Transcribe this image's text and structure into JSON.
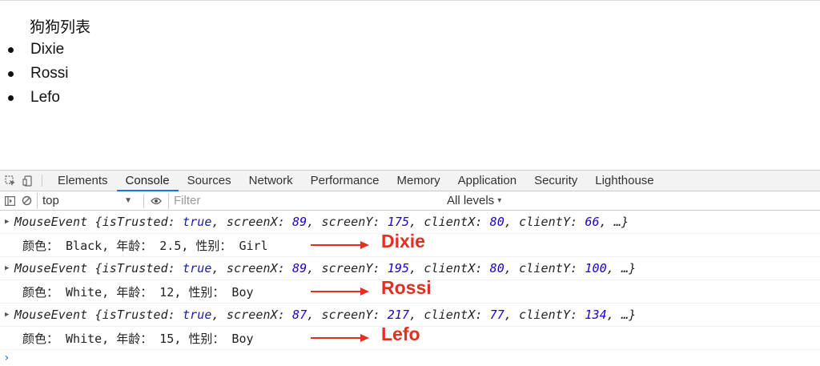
{
  "page": {
    "title": "狗狗列表",
    "dogs": [
      "Dixie",
      "Rossi",
      "Lefo"
    ]
  },
  "devtools": {
    "tabs": [
      "Elements",
      "Console",
      "Sources",
      "Network",
      "Performance",
      "Memory",
      "Application",
      "Security",
      "Lighthouse"
    ],
    "active_tab": "Console",
    "filterbar": {
      "context": "top",
      "filter_placeholder": "Filter",
      "levels": "All levels"
    },
    "messages": [
      {
        "type": "object",
        "name": "MouseEvent",
        "isTrusted": "true",
        "screenX": "89",
        "screenY": "175",
        "clientX": "80",
        "clientY": "66",
        "ellipsis": "…"
      },
      {
        "type": "log",
        "text": "颜色： Black, 年龄： 2.5, 性别： Girl",
        "annotation": "Dixie"
      },
      {
        "type": "object",
        "name": "MouseEvent",
        "isTrusted": "true",
        "screenX": "89",
        "screenY": "195",
        "clientX": "80",
        "clientY": "100",
        "ellipsis": "…"
      },
      {
        "type": "log",
        "text": "颜色： White, 年龄：  12, 性别： Boy",
        "annotation": "Rossi"
      },
      {
        "type": "object",
        "name": "MouseEvent",
        "isTrusted": "true",
        "screenX": "87",
        "screenY": "217",
        "clientX": "77",
        "clientY": "134",
        "ellipsis": "…"
      },
      {
        "type": "log",
        "text": "颜色： White, 年龄：  15, 性别： Boy",
        "annotation": "Lefo"
      }
    ],
    "prompt_symbol": "›"
  },
  "colors": {
    "accent": "#1a73e8",
    "annotation": "#e0301e",
    "keyword": "#1a1aa6",
    "number": "#1c00cf"
  }
}
